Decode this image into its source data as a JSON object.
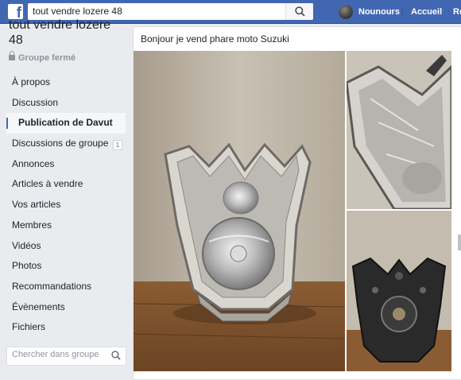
{
  "topbar": {
    "logo_letter": "f",
    "search_value": "tout vendre lozere 48",
    "user_name": "Nounours",
    "home_label": "Accueil",
    "overflow_label": "Re",
    "colors": {
      "bar": "#4267b2",
      "text": "#ffffff"
    }
  },
  "group": {
    "title": "tout vendre lozere 48",
    "privacy": "Groupe fermé"
  },
  "menu": {
    "items": [
      {
        "label": "À propos"
      },
      {
        "label": "Discussion"
      },
      {
        "label": "Publication de Davut",
        "active": true
      },
      {
        "label": "Discussions de groupe",
        "badge": "1"
      },
      {
        "label": "Annonces"
      },
      {
        "label": "Articles à vendre"
      },
      {
        "label": "Vos articles"
      },
      {
        "label": "Membres"
      },
      {
        "label": "Vidéos"
      },
      {
        "label": "Photos"
      },
      {
        "label": "Recommandations"
      },
      {
        "label": "Évènements"
      },
      {
        "label": "Fichiers"
      }
    ]
  },
  "group_search": {
    "placeholder": "Chercher dans groupe"
  },
  "post": {
    "text": "Bonjour je vend phare moto Suzuki",
    "photos": [
      {
        "icon": "headlight-front-photo"
      },
      {
        "icon": "headlight-side-photo"
      },
      {
        "icon": "headlight-back-photo"
      }
    ]
  }
}
